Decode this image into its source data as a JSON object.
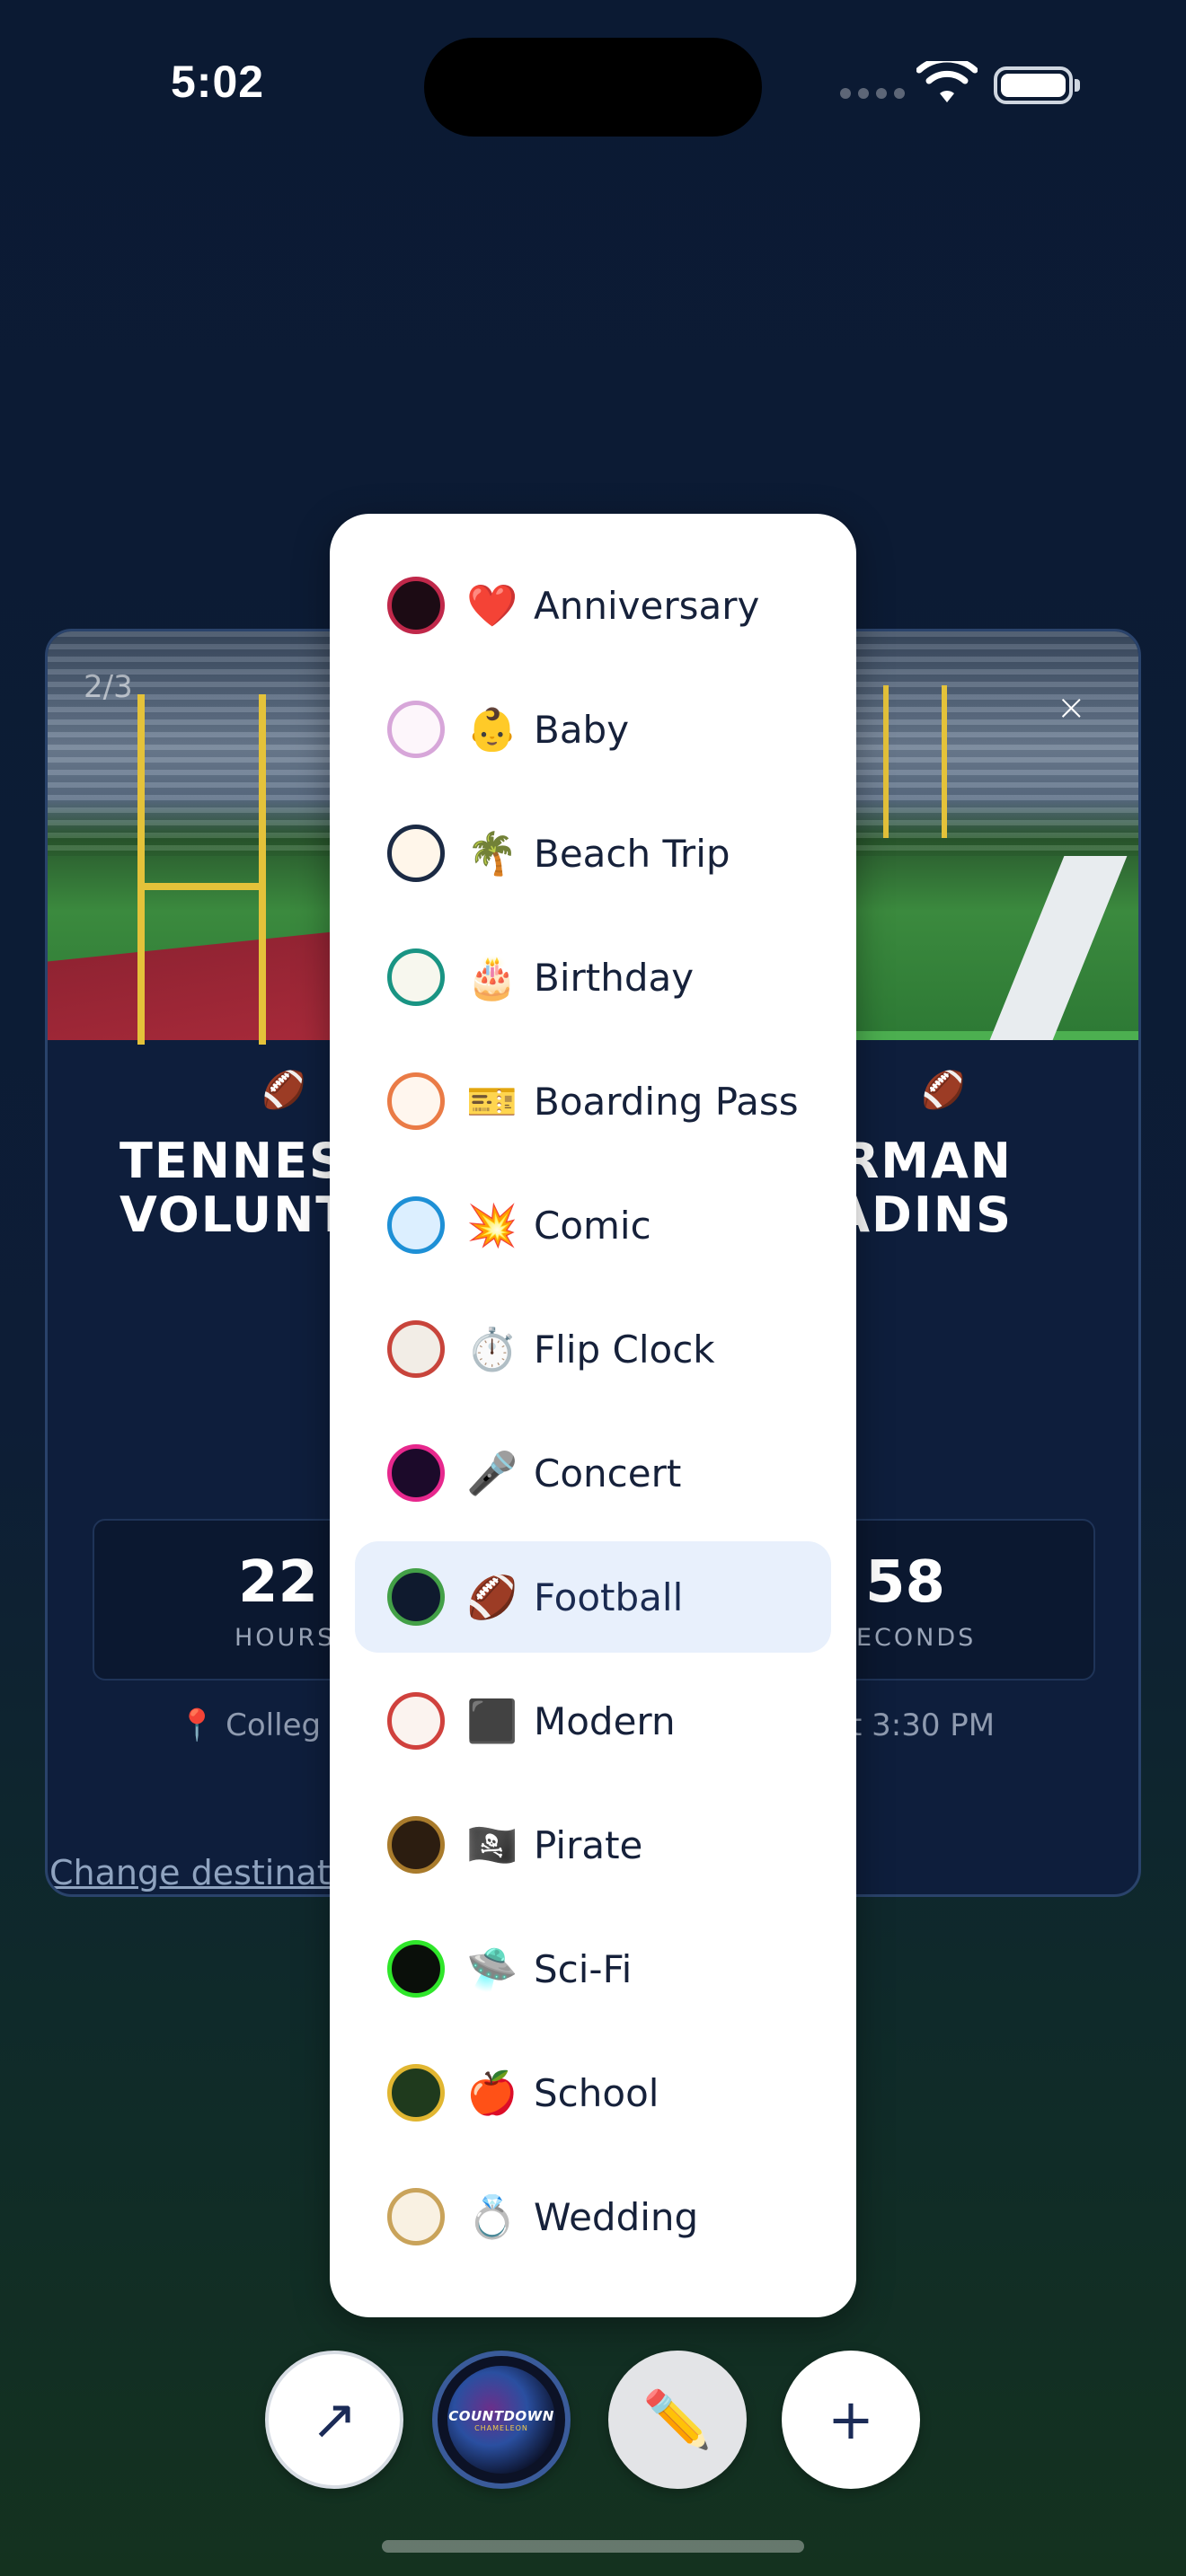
{
  "status_bar": {
    "time": "5:02"
  },
  "card": {
    "page_indicator": "2/3",
    "close_symbol": "×",
    "team_emoji": "🏈",
    "team_left_line1": "TENNES",
    "team_left_line2": "VOLUNT",
    "team_right_line1": "RMAN",
    "team_right_line2": "ADINS",
    "hours_value": "22",
    "hours_label": "HOURS",
    "seconds_value": "58",
    "seconds_label": "ECONDS",
    "venue": "📍 Colleg",
    "time_text": "t 3:30 PM",
    "change_destination": "Change destinat"
  },
  "theme_menu": {
    "selected": "Football",
    "items": [
      {
        "emoji": "❤️",
        "label": "Anniversary",
        "fill": "#1c0b14",
        "ring": "#c0284a"
      },
      {
        "emoji": "👶",
        "label": "Baby",
        "fill": "#fdf6fb",
        "ring": "#d7a6d9"
      },
      {
        "emoji": "🌴",
        "label": "Beach Trip",
        "fill": "#fff6ea",
        "ring": "#1b2a44"
      },
      {
        "emoji": "🎂",
        "label": "Birthday",
        "fill": "#f7f7ee",
        "ring": "#199483"
      },
      {
        "emoji": "🎫",
        "label": "Boarding Pass",
        "fill": "#fff6ee",
        "ring": "#ea7b46"
      },
      {
        "emoji": "💥",
        "label": "Comic",
        "fill": "#dcefff",
        "ring": "#1e90d6"
      },
      {
        "emoji": "⏱️",
        "label": "Flip Clock",
        "fill": "#f2ede6",
        "ring": "#c8443b"
      },
      {
        "emoji": "🎤",
        "label": "Concert",
        "fill": "#1c0a2a",
        "ring": "#e7288d"
      },
      {
        "emoji": "🏈",
        "label": "Football",
        "fill": "#0f1a2e",
        "ring": "#43a047"
      },
      {
        "emoji": "⬛",
        "label": "Modern",
        "fill": "#fbf3ef",
        "ring": "#d0413d"
      },
      {
        "emoji": "🏴‍☠️",
        "label": "Pirate",
        "fill": "#2c1d10",
        "ring": "#a97b2c"
      },
      {
        "emoji": "🛸",
        "label": "Sci-Fi",
        "fill": "#0a0f0a",
        "ring": "#2fe62a"
      },
      {
        "emoji": "🍎",
        "label": "School",
        "fill": "#1f3a1d",
        "ring": "#e1b631"
      },
      {
        "emoji": "💍",
        "label": "Wedding",
        "fill": "#f9f1e2",
        "ring": "#c9a35a"
      }
    ]
  },
  "toolbar": {
    "share_icon": "↗",
    "logo_text": "COUNTDOWN",
    "logo_sub": "CHAMELEON",
    "edit_icon": "✏️",
    "add_icon": "+"
  }
}
